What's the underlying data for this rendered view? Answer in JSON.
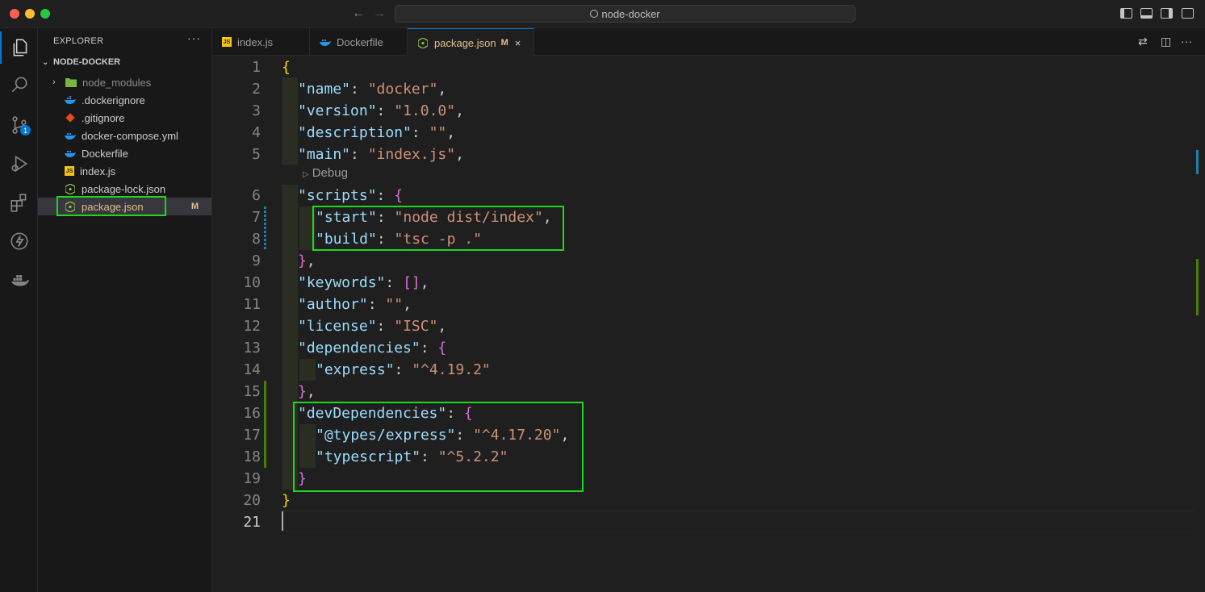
{
  "window": {
    "search_text": "node-docker",
    "back_icon": "arrow-left-icon",
    "forward_icon": "arrow-right-icon"
  },
  "activity_bar": {
    "source_control_badge": "1"
  },
  "explorer": {
    "title": "EXPLORER",
    "more": "···",
    "folder": "NODE-DOCKER",
    "items": [
      {
        "label": "node_modules",
        "icon": "folder-icon"
      },
      {
        "label": ".dockerignore",
        "icon": "docker-icon"
      },
      {
        "label": ".gitignore",
        "icon": "git-icon"
      },
      {
        "label": "docker-compose.yml",
        "icon": "docker-icon"
      },
      {
        "label": "Dockerfile",
        "icon": "docker-icon"
      },
      {
        "label": "index.js",
        "icon": "js-icon"
      },
      {
        "label": "package-lock.json",
        "icon": "node-icon"
      },
      {
        "label": "package.json",
        "icon": "node-icon",
        "status": "M"
      }
    ]
  },
  "tabs": [
    {
      "label": "index.js",
      "icon": "js-icon"
    },
    {
      "label": "Dockerfile",
      "icon": "docker-icon"
    },
    {
      "label": "package.json",
      "icon": "node-icon",
      "status": "M",
      "close": "×"
    }
  ],
  "editor": {
    "codelens": "Debug",
    "line_numbers": [
      "1",
      "2",
      "3",
      "4",
      "5",
      "6",
      "7",
      "8",
      "9",
      "10",
      "11",
      "12",
      "13",
      "14",
      "15",
      "16",
      "17",
      "18",
      "19",
      "20",
      "21"
    ],
    "tokens": {
      "l1_open": "{",
      "l2_key": "\"name\"",
      "l2_val": "\"docker\"",
      "l3_key": "\"version\"",
      "l3_val": "\"1.0.0\"",
      "l4_key": "\"description\"",
      "l4_val": "\"\"",
      "l5_key": "\"main\"",
      "l5_val": "\"index.js\"",
      "l6_key": "\"scripts\"",
      "l6_open": "{",
      "l7_key": "\"start\"",
      "l7_val": "\"node dist/index\"",
      "l8_key": "\"build\"",
      "l8_val": "\"tsc -p .\"",
      "l9_close": "}",
      "l10_key": "\"keywords\"",
      "l10_val": "[]",
      "l11_key": "\"author\"",
      "l11_val": "\"\"",
      "l12_key": "\"license\"",
      "l12_val": "\"ISC\"",
      "l13_key": "\"dependencies\"",
      "l13_open": "{",
      "l14_key": "\"express\"",
      "l14_val": "\"^4.19.2\"",
      "l15_close": "}",
      "l16_key": "\"devDependencies\"",
      "l16_open": "{",
      "l17_key": "\"@types/express\"",
      "l17_val": "\"^4.17.20\"",
      "l18_key": "\"typescript\"",
      "l18_val": "\"^5.2.2\"",
      "l19_close": "}",
      "l20_close": "}",
      "colon": ": ",
      "comma": ","
    }
  }
}
